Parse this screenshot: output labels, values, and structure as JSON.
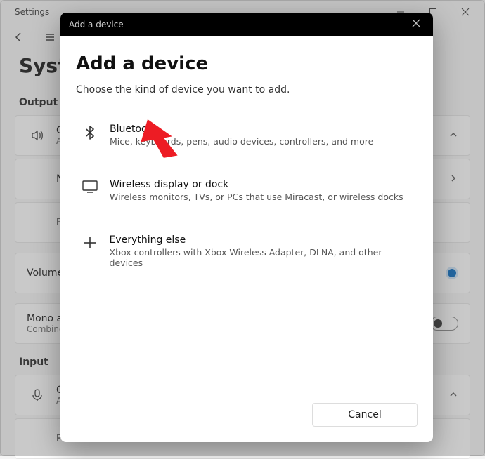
{
  "window": {
    "title": "Settings",
    "page_title": "System"
  },
  "sections": {
    "output": {
      "label": "Output",
      "row0_title_initial": "C",
      "row0_sub_initial": "A",
      "row1_title_initial": "N",
      "row2_title_initial": "P",
      "volume_label": "Volume",
      "mono_title": "Mono a",
      "mono_sub": "Combine"
    },
    "input": {
      "label": "Input",
      "row0_title_initial": "C",
      "row0_sub_initial": "A",
      "row1_title_initial": "P"
    }
  },
  "modal": {
    "titlebar": "Add a device",
    "heading": "Add a device",
    "subheading": "Choose the kind of device you want to add.",
    "options": [
      {
        "title": "Bluetooth",
        "desc": "Mice, keyboards, pens, audio devices, controllers, and more"
      },
      {
        "title": "Wireless display or dock",
        "desc": "Wireless monitors, TVs, or PCs that use Miracast, or wireless docks"
      },
      {
        "title": "Everything else",
        "desc": "Xbox controllers with Xbox Wireless Adapter, DLNA, and other devices"
      }
    ],
    "cancel": "Cancel"
  }
}
